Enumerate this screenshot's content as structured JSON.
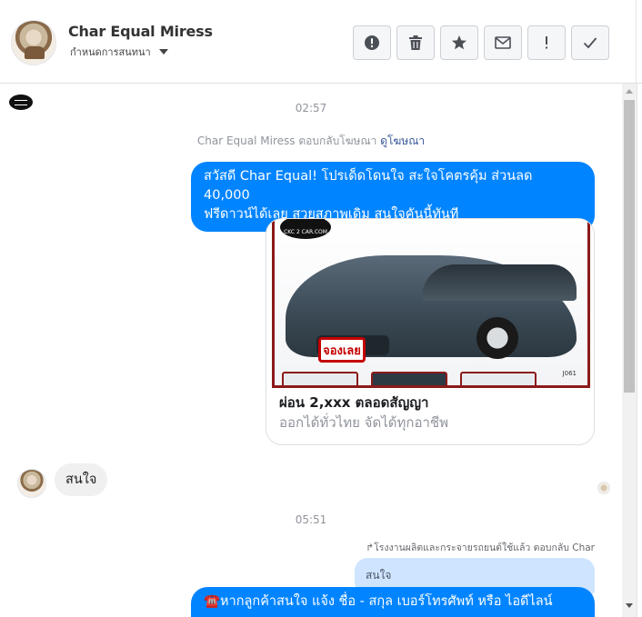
{
  "header": {
    "contact_name": "Char Equal Miress",
    "assign_label": "กำหนดการสนทนา",
    "assign_icon": "chevron-down-icon",
    "toolbar": [
      {
        "name": "mark-spam-button",
        "icon": "exclamation-circle-icon"
      },
      {
        "name": "delete-button",
        "icon": "trash-icon"
      },
      {
        "name": "star-button",
        "icon": "star-icon"
      },
      {
        "name": "mark-unread-button",
        "icon": "envelope-icon"
      },
      {
        "name": "follow-up-button",
        "icon": "exclamation-icon"
      },
      {
        "name": "mark-done-button",
        "icon": "checkmark-icon"
      }
    ]
  },
  "conversation": {
    "time_1": "02:57",
    "ad_reply_note": "Char Equal Miress ตอบกลับโฆษณา",
    "ad_reply_link": "ดูโฆษณา",
    "outgoing_1_line1": "สวัสดี Char Equal! โปรเด็ดโดนใจ สะใจโคตรคุ้ม ส่วนลด 40,000",
    "outgoing_1_line2": "ฟรีดาวน์ได้เลย สวยสภาพเดิม สนใจคันนี้ทันที",
    "card": {
      "image_badge": "จองเลย",
      "image_logo": "CKC 2 CAR.COM",
      "image_code": "J061",
      "title": "ผ่อน 2,xxx ตลอดสัญญา",
      "subtitle": "ออกได้ทั่วไทย จัดได้ทุกอาชีพ"
    },
    "incoming_1": "สนใจ",
    "time_2": "05:51",
    "reply_context": "↱โรงงานผลิตและกระจายรถยนต์ใช้แล้ว ตอบกลับ Char",
    "quoted_text": "สนใจ",
    "outgoing_2_line1": "☎️หากลูกค้าสนใจ แจ้ง ชื่อ - สกุล เบอร์โทรศัพท์ หรือ ไอดีไลน์"
  }
}
